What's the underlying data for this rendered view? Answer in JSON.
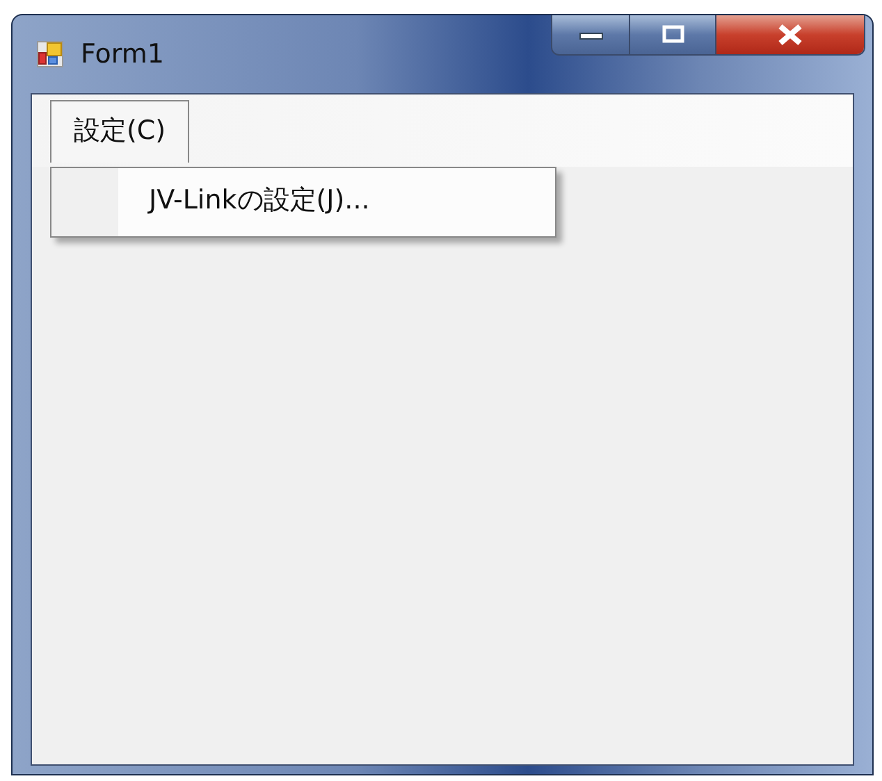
{
  "window": {
    "title": "Form1"
  },
  "menu": {
    "items": [
      {
        "label": "設定(C)",
        "selected": true,
        "children": [
          {
            "label": "JV-Linkの設定(J)..."
          }
        ]
      }
    ]
  }
}
